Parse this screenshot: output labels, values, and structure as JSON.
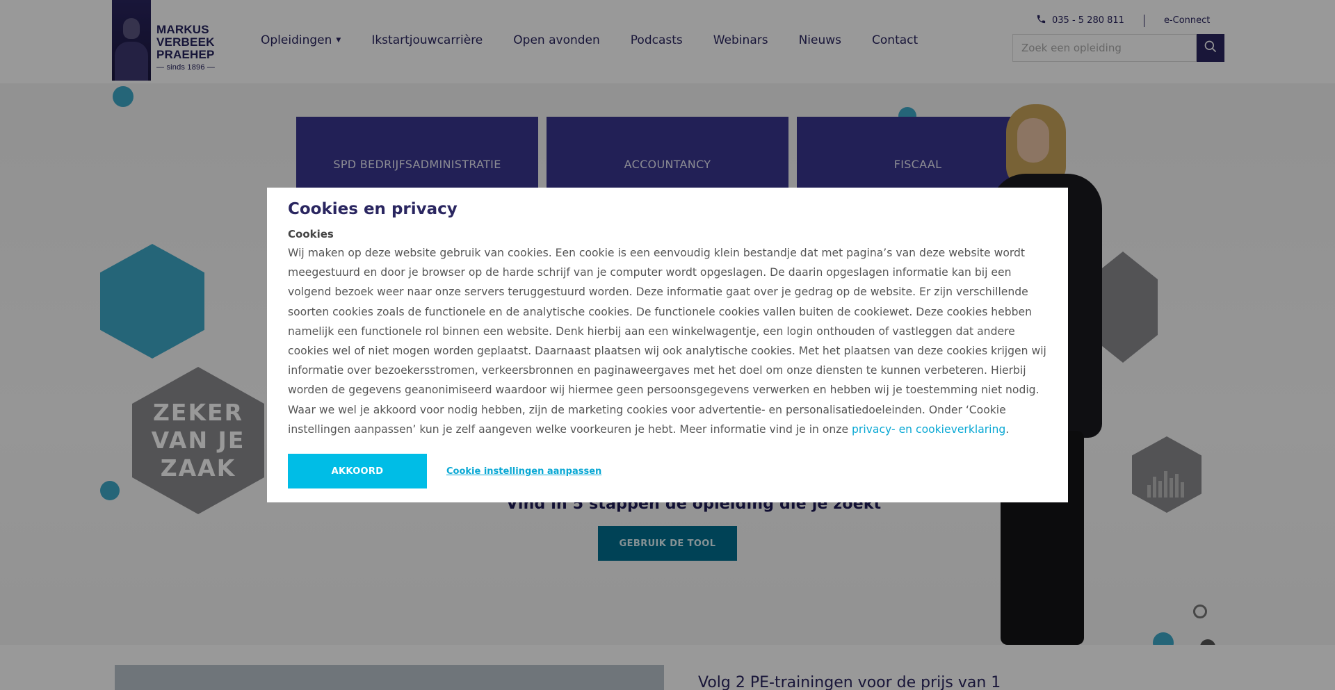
{
  "logo": {
    "line1": "MARKUS",
    "line2": "VERBEEK",
    "line3": "PRAEHEP",
    "sub": "— sinds 1896 —"
  },
  "nav": {
    "items": [
      {
        "label": "Opleidingen",
        "has_dropdown": true
      },
      {
        "label": "Ikstartjouwcarrière"
      },
      {
        "label": "Open avonden"
      },
      {
        "label": "Podcasts"
      },
      {
        "label": "Webinars"
      },
      {
        "label": "Nieuws"
      },
      {
        "label": "Contact"
      }
    ]
  },
  "topbar": {
    "phone": "035 - 5 280 811",
    "econnect": "e-Connect",
    "phone_icon": "phone-icon"
  },
  "search": {
    "placeholder": "Zoek een opleiding",
    "icon": "search-icon"
  },
  "hero": {
    "categories": [
      "SPD BEDRIJFSADMINISTRATIE",
      "ACCOUNTANCY",
      "FISCAAL"
    ],
    "slogan": [
      "ZEKER",
      "VAN JE",
      "ZAAK"
    ],
    "finder_title": "Vind in 5 stappen de opleiding die je zoekt",
    "finder_button": "GEBRUIK DE TOOL"
  },
  "teaser": {
    "title": "Volg 2 PE-trainingen voor de prijs van 1"
  },
  "cookie_modal": {
    "title": "Cookies en privacy",
    "subtitle": "Cookies",
    "body": "Wij maken op deze website gebruik van cookies. Een cookie is een eenvoudig klein bestandje dat met pagina’s van deze website wordt meegestuurd en door je browser op de harde schrijf van je computer wordt opgeslagen. De daarin opgeslagen informatie kan bij een volgend bezoek weer naar onze servers teruggestuurd worden. Deze informatie gaat over je gedrag op de website. Er zijn verschillende soorten cookies zoals de functionele en de analytische cookies. De functionele cookies vallen buiten de cookiewet. Deze cookies hebben namelijk een functionele rol binnen een website. Denk hierbij aan een winkelwagentje, een login onthouden of vastleggen dat andere cookies wel of niet mogen worden geplaatst. Daarnaast plaatsen wij ook analytische cookies. Met het plaatsen van deze cookies krijgen wij informatie over bezoekersstromen, verkeersbronnen en paginaweergaves met het doel om onze diensten te kunnen verbeteren. Hierbij worden de gegevens geanonimiseerd waardoor wij hiermee geen persoonsgegevens verwerken en hebben wij je toestemming niet nodig. Waar we wel je akkoord voor nodig hebben, zijn de marketing cookies voor advertentie- en personalisatiedoeleinden. Onder ‘Cookie instellingen aanpassen’ kun je zelf aangeven welke voorkeuren je hebt. Meer informatie vind je in onze ",
    "link_text": "privacy- en cookieverklaring",
    "body_end": ".",
    "accept_button": "AKKOORD",
    "settings_link": "Cookie instellingen aanpassen"
  },
  "colors": {
    "brand": "#2a2660",
    "accent": "#00bde6",
    "link": "#0aa8d4",
    "tool_button": "#006f8f"
  }
}
